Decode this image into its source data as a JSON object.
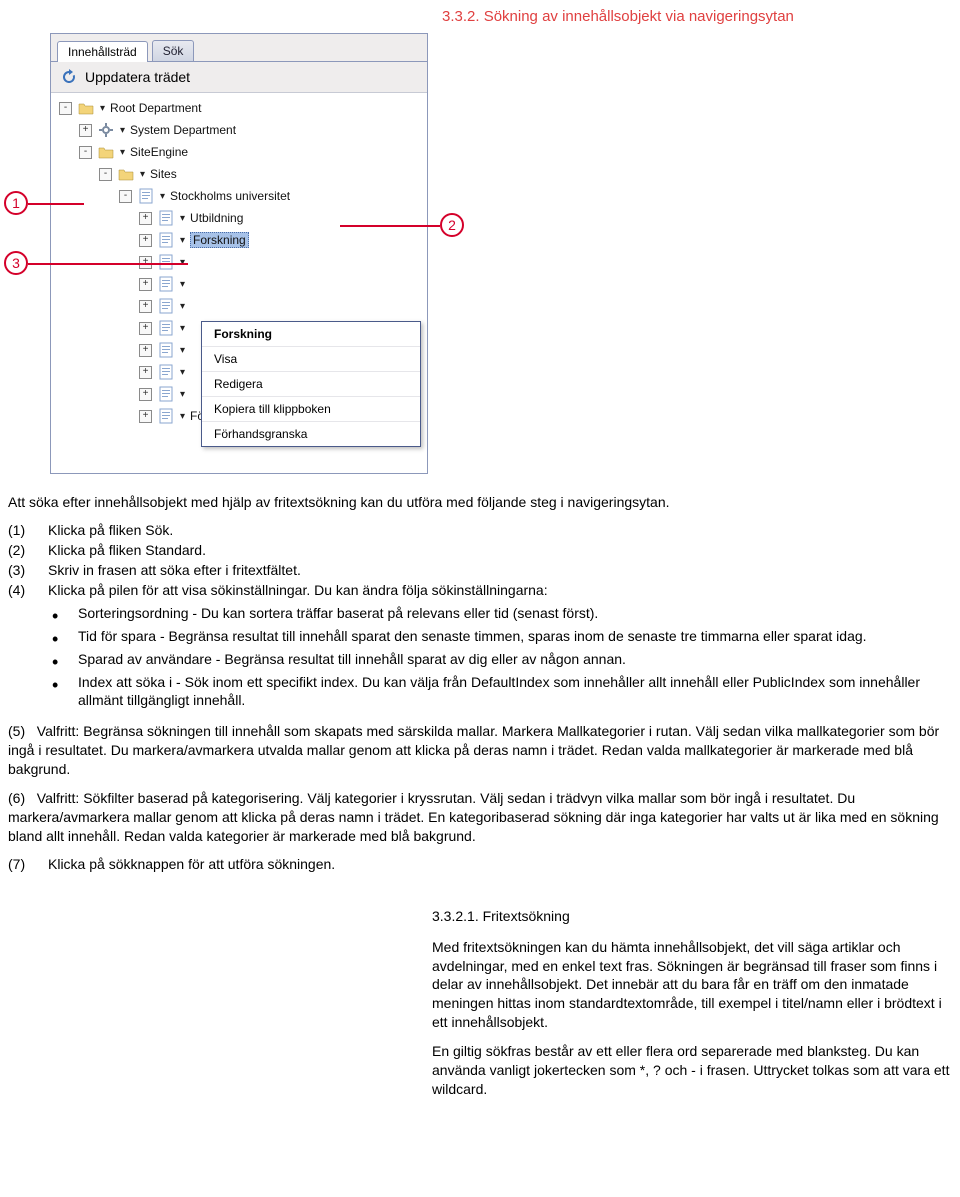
{
  "heading": "3.3.2. Sökning av innehållsobjekt via navigeringsytan",
  "tabs": {
    "tree": "Innehållsträd",
    "search": "Sök"
  },
  "refresh_label": "Uppdatera trädet",
  "tree": [
    {
      "indent": 0,
      "exp": "-",
      "label": "Root Department"
    },
    {
      "indent": 1,
      "exp": "+",
      "label": "System Department"
    },
    {
      "indent": 1,
      "exp": "-",
      "label": "SiteEngine"
    },
    {
      "indent": 2,
      "exp": "-",
      "label": "Sites"
    },
    {
      "indent": 3,
      "exp": "-",
      "label": "Stockholms universitet"
    },
    {
      "indent": 4,
      "exp": "+",
      "label": "Utbildning"
    },
    {
      "indent": 4,
      "exp": "+",
      "label": "Forskning",
      "selected": true
    },
    {
      "indent": 4,
      "exp": "+",
      "label": ""
    },
    {
      "indent": 4,
      "exp": "+",
      "label": ""
    },
    {
      "indent": 4,
      "exp": "+",
      "label": ""
    },
    {
      "indent": 4,
      "exp": "+",
      "label": ""
    },
    {
      "indent": 4,
      "exp": "+",
      "label": ""
    },
    {
      "indent": 4,
      "exp": "+",
      "label": ""
    },
    {
      "indent": 4,
      "exp": "+",
      "label": ""
    },
    {
      "indent": 4,
      "exp": "+",
      "label": "Förvaltningen"
    }
  ],
  "context_menu": [
    "Forskning",
    "Visa",
    "Redigera",
    "Kopiera till klippboken",
    "Förhandsgranska"
  ],
  "callouts": {
    "c1": "1",
    "c2": "2",
    "c3": "3"
  },
  "intro": "Att söka efter innehållsobjekt med hjälp av fritextsökning kan du utföra med följande steg i navigeringsytan.",
  "steps": {
    "s1": {
      "n": "(1)",
      "t": "Klicka på fliken Sök."
    },
    "s2": {
      "n": "(2)",
      "t": "Klicka på fliken Standard."
    },
    "s3": {
      "n": "(3)",
      "t": "Skriv in frasen att söka efter i fritextfältet."
    },
    "s4": {
      "n": "(4)",
      "t": "Klicka på pilen för att visa sökinställningar. Du kan ändra följa sökinställningarna:"
    },
    "s5": {
      "n": "(5)",
      "t": "Valfritt: Begränsa sökningen till innehåll som skapats med särskilda mallar. Markera Mallkategorier i rutan. Välj sedan vilka mallkategorier som bör ingå i resultatet. Du markera/avmarkera utvalda mallar genom att klicka på deras namn i trädet. Redan valda mallkategorier är markerade med blå bakgrund."
    },
    "s6": {
      "n": "(6)",
      "t": "Valfritt: Sökfilter baserad på kategorisering. Välj kategorier i kryssrutan. Välj sedan i trädvyn vilka mallar som bör ingå i resultatet. Du markera/avmarkera mallar genom att klicka på deras namn i trädet. En kategoribaserad sökning där inga kategorier har valts ut är lika med en sökning bland allt innehåll. Redan valda kategorier är markerade med blå bakgrund."
    },
    "s7": {
      "n": "(7)",
      "t": "Klicka på sökknappen för att utföra sökningen."
    }
  },
  "bullets": [
    "Sorteringsordning - Du kan sortera träffar baserat på relevans eller tid (senast först).",
    "Tid för spara - Begränsa resultat till innehåll sparat den senaste timmen, sparas inom de senaste tre timmarna eller sparat idag.",
    "Sparad av användare - Begränsa resultat till innehåll sparat av dig eller av någon annan.",
    "Index att söka i - Sök inom ett specifikt index. Du kan välja från DefaultIndex som innehåller allt innehåll eller PublicIndex som innehåller allmänt tillgängligt innehåll."
  ],
  "sub": {
    "title": "3.3.2.1. Fritextsökning",
    "p1": "Med fritextsökningen kan du hämta innehållsobjekt, det vill säga artiklar och avdelningar, med en enkel text fras. Sökningen är begränsad till fraser som finns i delar av innehållsobjekt. Det innebär att du bara får en träff om den inmatade meningen hittas inom standardtextområde, till exempel i titel/namn eller i brödtext i ett innehållsobjekt.",
    "p2": "En giltig sökfras består av ett eller flera ord separerade med blanksteg. Du kan använda vanligt jokertecken som *, ? och - i frasen. Uttrycket tolkas som att vara ett wildcard."
  }
}
